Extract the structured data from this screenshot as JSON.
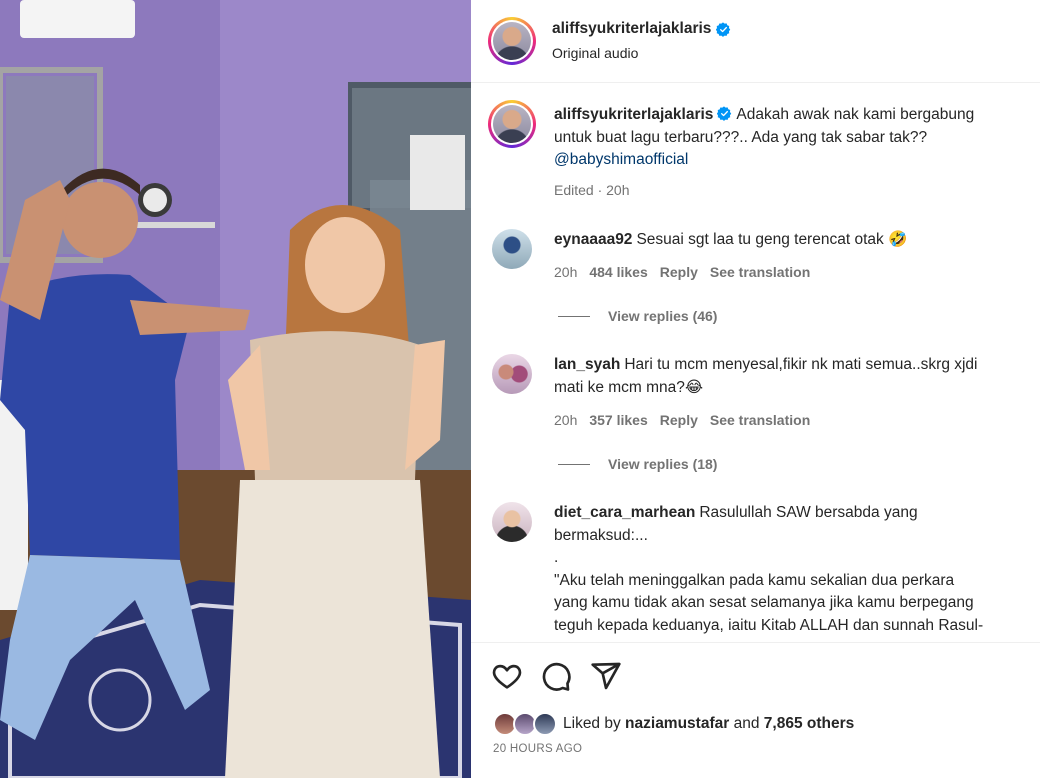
{
  "post": {
    "username": "aliffsyukriterlajaklaris",
    "audio": "Original audio"
  },
  "caption": {
    "username": "aliffsyukriterlajaklaris",
    "line1": "Adakah awak nak kami bergabung",
    "line2": "untuk buat lagu terbaru???.. Ada yang tak sabar tak??",
    "mention": "@babyshimaofficial",
    "meta": "Edited · 20h"
  },
  "comments": [
    {
      "username": "eynaaaa92",
      "text": "Sesuai sgt laa tu geng terencat otak 🤣",
      "time": "20h",
      "likes": "484 likes",
      "reply": "Reply",
      "translate": "See translation",
      "view_replies": "View replies (46)"
    },
    {
      "username": "lan_syah",
      "text_line1": "Hari tu mcm menyesal,fikir nk mati semua..skrg xjdi",
      "text_line2": "mati ke mcm mna?😂",
      "time": "20h",
      "likes": "357 likes",
      "reply": "Reply",
      "translate": "See translation",
      "view_replies": "View replies (18)"
    },
    {
      "username": "diet_cara_marhean",
      "text_line1": "Rasulullah SAW bersabda yang",
      "text_line2": "bermaksud:...",
      "text_line3": ".",
      "text_line4": "\"Aku telah meninggalkan pada kamu sekalian dua perkara",
      "text_line5": "yang kamu tidak akan sesat selamanya jika kamu berpegang",
      "text_line6": "teguh kepada keduanya, iaitu Kitab ALLAH dan sunnah Rasul-"
    }
  ],
  "likes": {
    "prefix": "Liked by",
    "user": "naziamustafar",
    "and": "and",
    "others": "7,865 others"
  },
  "timestamp": "20 HOURS AGO",
  "icons": {
    "like": "heart-icon",
    "comment": "comment-icon",
    "share": "share-icon",
    "verified": "verified-badge-icon"
  },
  "colors": {
    "verified": "#0095f6",
    "mention": "#00376b",
    "muted": "#737373"
  }
}
